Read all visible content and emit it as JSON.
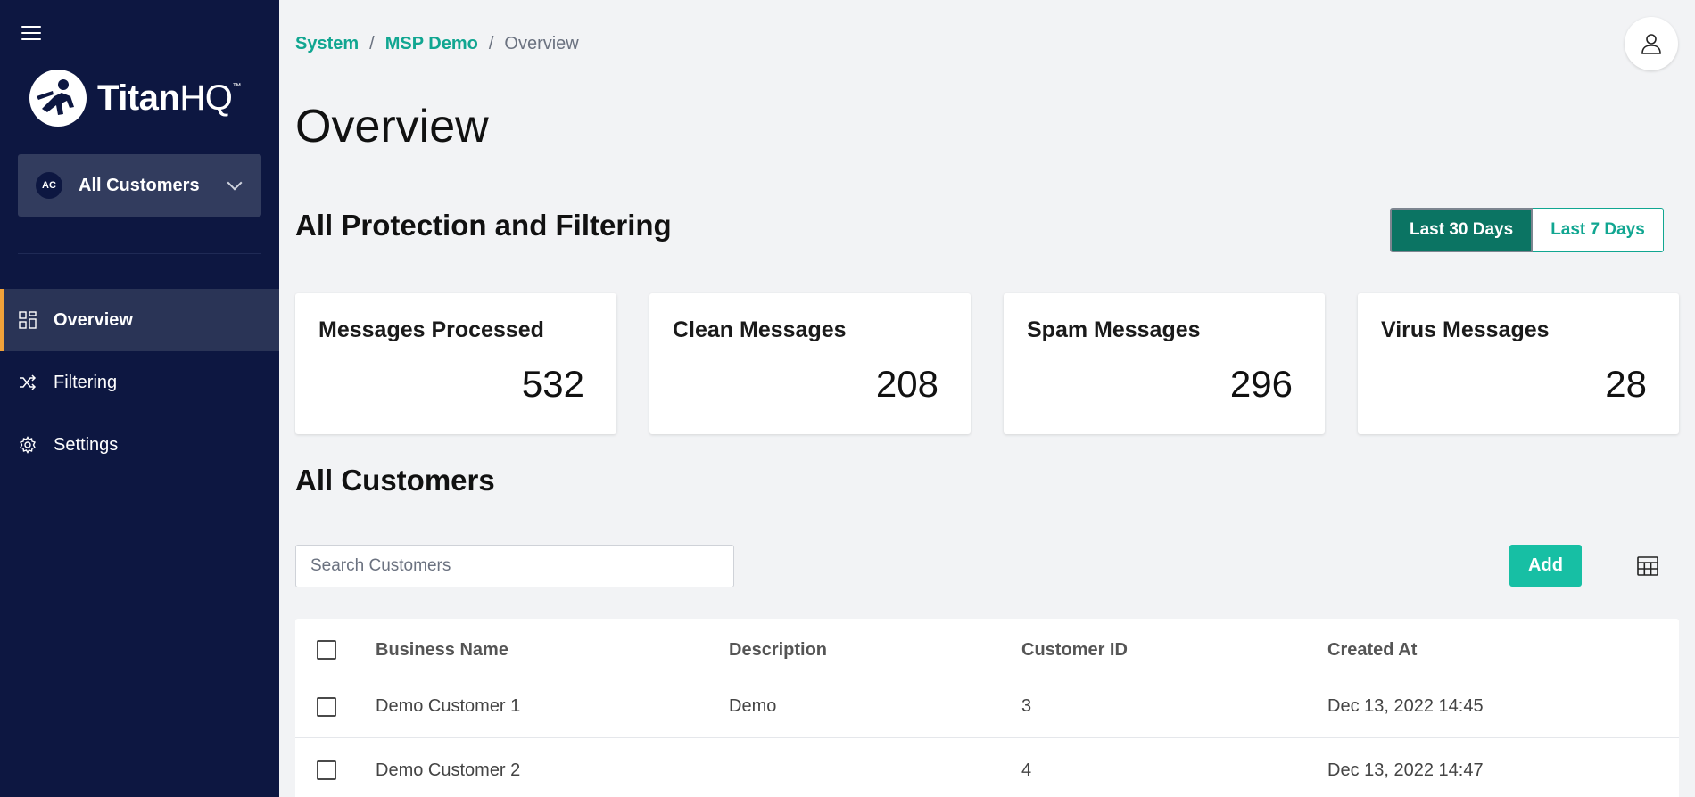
{
  "sidebar": {
    "logo": {
      "text_bold": "Titan",
      "text_light": "HQ",
      "tm": "™"
    },
    "customer_selector": {
      "badge": "AC",
      "label": "All Customers"
    },
    "nav": [
      {
        "label": "Overview",
        "icon": "dashboard-icon",
        "active": true
      },
      {
        "label": "Filtering",
        "icon": "shuffle-icon",
        "active": false
      },
      {
        "label": "Settings",
        "icon": "gear-icon",
        "active": false
      }
    ]
  },
  "breadcrumb": {
    "items": [
      "System",
      "MSP Demo"
    ],
    "current": "Overview",
    "separator": "/"
  },
  "page_title": "Overview",
  "protection": {
    "title": "All Protection and Filtering",
    "ranges": [
      "Last 30 Days",
      "Last 7 Days"
    ],
    "selected_range": "Last 30 Days",
    "cards": [
      {
        "title": "Messages Processed",
        "value": "532"
      },
      {
        "title": "Clean Messages",
        "value": "208"
      },
      {
        "title": "Spam Messages",
        "value": "296"
      },
      {
        "title": "Virus Messages",
        "value": "28"
      }
    ]
  },
  "customers": {
    "title": "All Customers",
    "search_placeholder": "Search Customers",
    "add_label": "Add",
    "columns": [
      "Business Name",
      "Description",
      "Customer ID",
      "Created At"
    ],
    "rows": [
      {
        "name": "Demo Customer 1",
        "description": "Demo",
        "id": "3",
        "created": "Dec 13, 2022 14:45"
      },
      {
        "name": "Demo Customer 2",
        "description": "",
        "id": "4",
        "created": "Dec 13, 2022 14:47"
      }
    ]
  },
  "colors": {
    "sidebar_bg": "#0d1741",
    "accent": "#17bfa4",
    "link": "#11a691",
    "active_toggle": "#0b7463",
    "active_marker": "#f0a23a"
  }
}
